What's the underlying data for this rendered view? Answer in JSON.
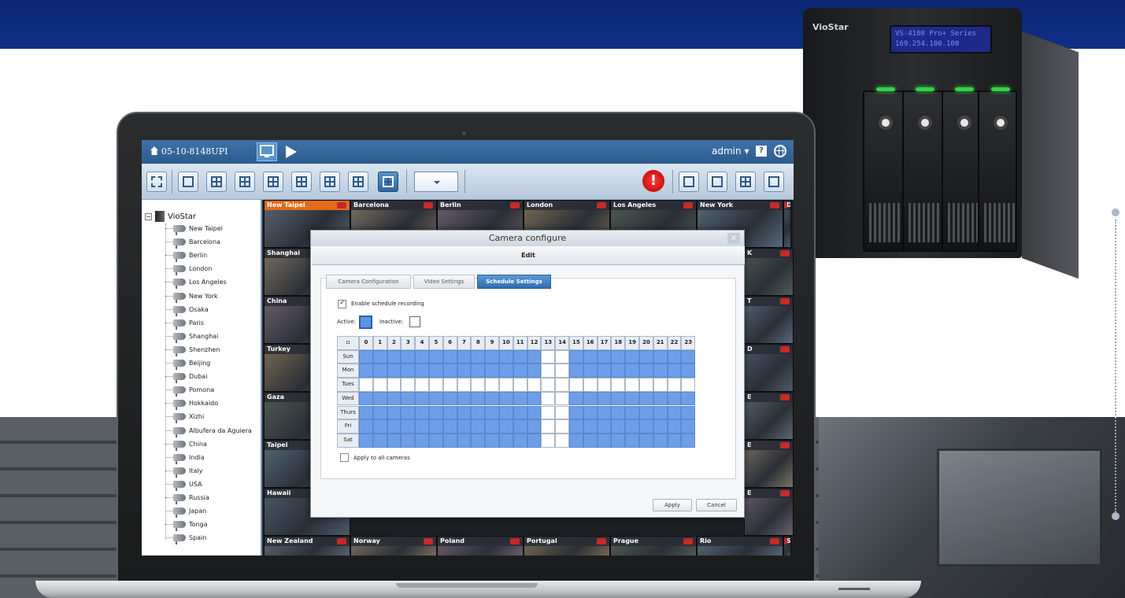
{
  "app": {
    "server_name": "05-10-8148UPI",
    "user": "admin",
    "user_caret": "▾",
    "help_glyph": "?",
    "alert_glyph": "!"
  },
  "nas": {
    "brand": "VioStar",
    "lcd_line1": "VS-4108 Pro+ Series",
    "lcd_line2": "169.254.100.100"
  },
  "tree": {
    "root_label": "VioStar",
    "items": [
      "New Taipei",
      "Barcelona",
      "Berlin",
      "London",
      "Los Angeles",
      "New York",
      "Osaka",
      "Paris",
      "Shanghai",
      "Shenzhen",
      "Beijing",
      "Dubai",
      "Pomona",
      "Hokkaido",
      "Xizhi",
      "Albufera da Aguiera",
      "China",
      "India",
      "Italy",
      "USA",
      "Russia",
      "Japan",
      "Tonga",
      "Spain"
    ]
  },
  "grid": {
    "top_row": [
      "New Taipei",
      "Barcelona",
      "Berlin",
      "London",
      "Los Angeles",
      "New York",
      "D"
    ],
    "left_col": [
      "Shanghai",
      "China",
      "Turkey",
      "Gaza",
      "Taipei",
      "Hawaii"
    ],
    "bottom_row": [
      "New Zealand",
      "Norway",
      "Poland",
      "Portugal",
      "Prague",
      "Rio",
      "S"
    ],
    "right_col": [
      "K",
      "T",
      "D",
      "E",
      "E",
      "E"
    ]
  },
  "dialog": {
    "title": "Camera configure",
    "close_glyph": "×",
    "subtitle": "Edit",
    "tabs": [
      "Camera Configuration",
      "Video Settings",
      "Schedule Settings"
    ],
    "active_tab": 2,
    "enable_label": "Enable schedule recording",
    "active_label": "Active:",
    "inactive_label": "Inactive:",
    "apply_all_label": "Apply to all cameras",
    "apply_button": "Apply",
    "cancel_button": "Cancel",
    "corner_glyph": "::",
    "colors": {
      "active": "#6f9ee8",
      "inactive": "#ffffff"
    }
  },
  "schedule": {
    "hours": [
      "0",
      "1",
      "2",
      "3",
      "4",
      "5",
      "6",
      "7",
      "8",
      "9",
      "10",
      "11",
      "12",
      "13",
      "14",
      "15",
      "16",
      "17",
      "18",
      "19",
      "20",
      "21",
      "22",
      "23"
    ],
    "days": [
      "Sun",
      "Mon",
      "Tues",
      "Wed",
      "Thurs",
      "Fri",
      "Sat"
    ],
    "active_rows": [
      [
        1,
        1,
        1,
        1,
        1,
        1,
        1,
        1,
        1,
        1,
        1,
        1,
        1,
        0,
        0,
        1,
        1,
        1,
        1,
        1,
        1,
        1,
        1,
        1
      ],
      [
        1,
        1,
        1,
        1,
        1,
        1,
        1,
        1,
        1,
        1,
        1,
        1,
        1,
        0,
        0,
        1,
        1,
        1,
        1,
        1,
        1,
        1,
        1,
        1
      ],
      [
        0,
        0,
        0,
        0,
        0,
        0,
        0,
        0,
        0,
        0,
        0,
        0,
        0,
        0,
        0,
        0,
        0,
        0,
        0,
        0,
        0,
        0,
        0,
        0
      ],
      [
        1,
        1,
        1,
        1,
        1,
        1,
        1,
        1,
        1,
        1,
        1,
        1,
        1,
        0,
        0,
        1,
        1,
        1,
        1,
        1,
        1,
        1,
        1,
        1
      ],
      [
        1,
        1,
        1,
        1,
        1,
        1,
        1,
        1,
        1,
        1,
        1,
        1,
        1,
        0,
        0,
        1,
        1,
        1,
        1,
        1,
        1,
        1,
        1,
        1
      ],
      [
        1,
        1,
        1,
        1,
        1,
        1,
        1,
        1,
        1,
        1,
        1,
        1,
        1,
        0,
        0,
        1,
        1,
        1,
        1,
        1,
        1,
        1,
        1,
        1
      ],
      [
        1,
        1,
        1,
        1,
        1,
        1,
        1,
        1,
        1,
        1,
        1,
        1,
        1,
        0,
        0,
        1,
        1,
        1,
        1,
        1,
        1,
        1,
        1,
        1
      ]
    ]
  }
}
